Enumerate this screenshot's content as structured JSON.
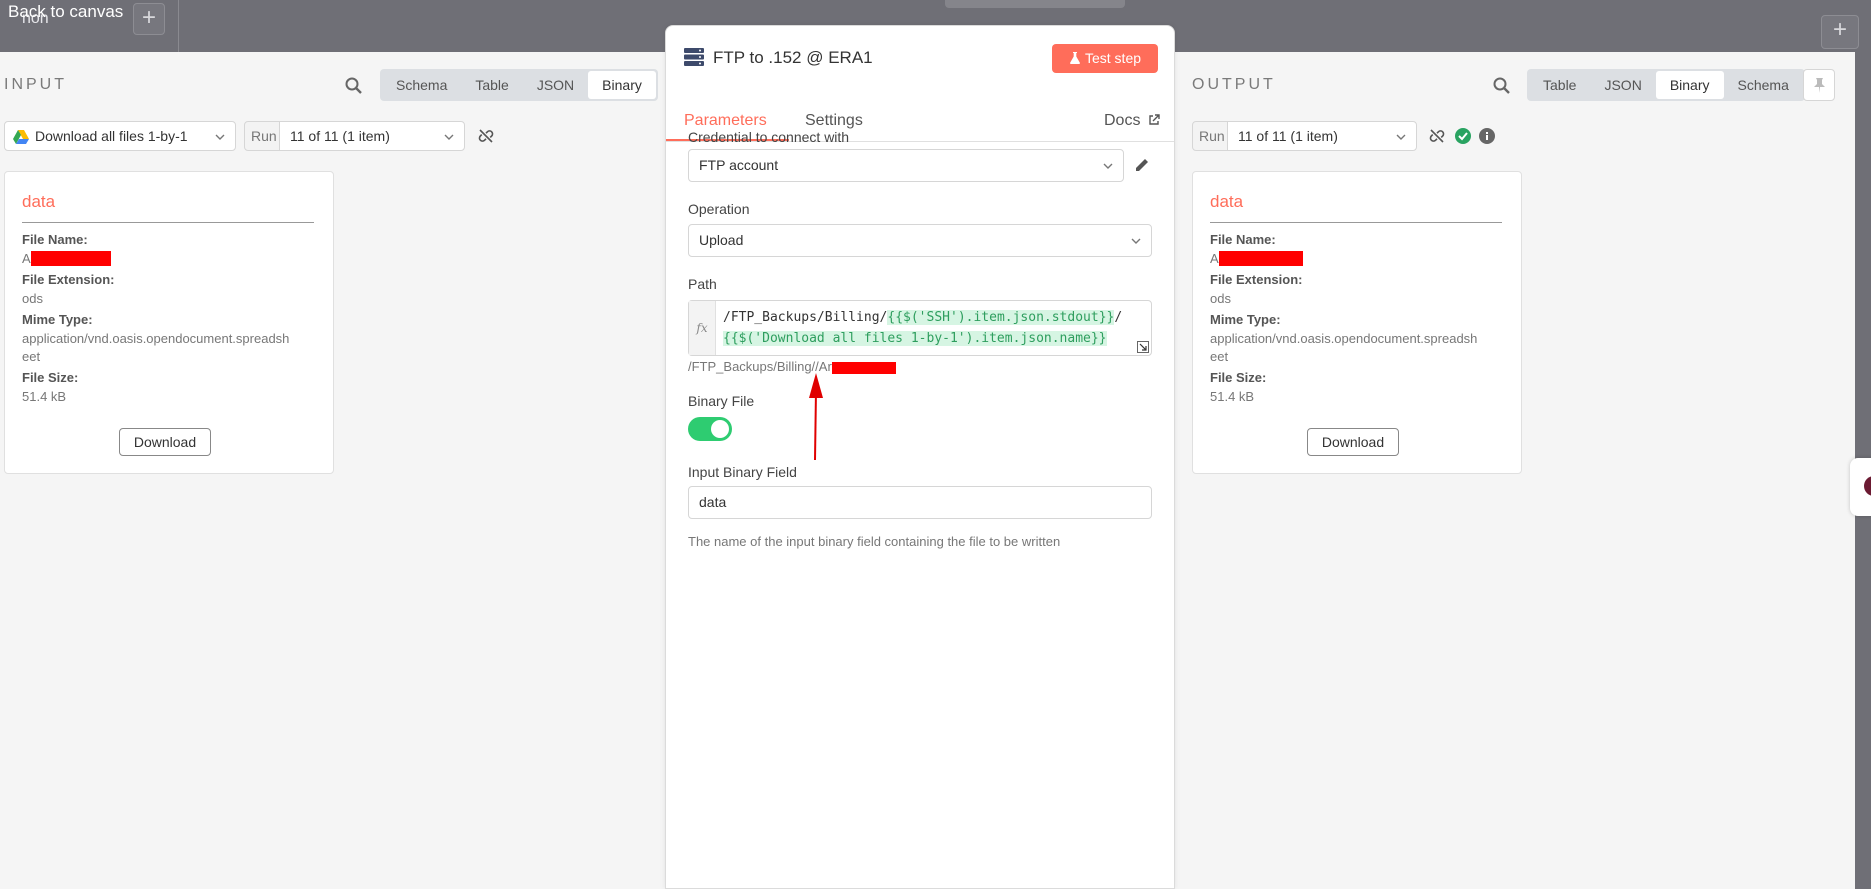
{
  "topbar": {
    "back_label": "Back to canvas",
    "workflow_name": "non",
    "plus": "+"
  },
  "input": {
    "title": "INPUT",
    "view_tabs": [
      "Schema",
      "Table",
      "JSON",
      "Binary"
    ],
    "active_tab": "Binary",
    "node_select": "Download all files 1-by-1",
    "run_label": "Run",
    "run_value": "11 of 11 (1 item)",
    "card": {
      "title": "data",
      "file_name_label": "File Name:",
      "file_name_prefix": "A",
      "file_ext_label": "File Extension:",
      "file_ext": "ods",
      "mime_label": "Mime Type:",
      "mime_line1": "application/vnd.oasis.opendocument.spreadsh",
      "mime_line2": "eet",
      "size_label": "File Size:",
      "size": "51.4 kB",
      "download": "Download"
    }
  },
  "node": {
    "title": "FTP to .152 @ ERA1",
    "test_step": "Test step",
    "tabs": {
      "parameters": "Parameters",
      "settings": "Settings",
      "docs": "Docs"
    },
    "credential_label": "Credential to connect with",
    "credential_value": "FTP account",
    "operation_label": "Operation",
    "operation_value": "Upload",
    "path_label": "Path",
    "path_fx": "fx",
    "path_expr_static": "/FTP_Backups/Billing/",
    "path_expr_hl1": "{{$('SSH').item.json.stdout}}",
    "path_expr_slash": "/",
    "path_expr_hl2": "{{$('Download all files 1-by-1').item.json.name}}",
    "path_resolved": "/FTP_Backups/Billing//Ar",
    "binary_file_label": "Binary File",
    "binary_file_enabled": true,
    "input_field_label": "Input Binary Field",
    "input_field_value": "data",
    "input_field_help": "The name of the input binary field containing the file to be written"
  },
  "output": {
    "title": "OUTPUT",
    "view_tabs": [
      "Table",
      "JSON",
      "Binary",
      "Schema"
    ],
    "active_tab": "Binary",
    "run_label": "Run",
    "run_value": "11 of 11 (1 item)",
    "card": {
      "title": "data",
      "file_name_label": "File Name:",
      "file_name_prefix": "A",
      "file_ext_label": "File Extension:",
      "file_ext": "ods",
      "mime_label": "Mime Type:",
      "mime_line1": "application/vnd.oasis.opendocument.spreadsh",
      "mime_line2": "eet",
      "size_label": "File Size:",
      "size": "51.4 kB",
      "download": "Download"
    }
  },
  "colors": {
    "accent": "#ff6d5a",
    "success": "#2ecc71",
    "redaction": "#ff0000"
  }
}
